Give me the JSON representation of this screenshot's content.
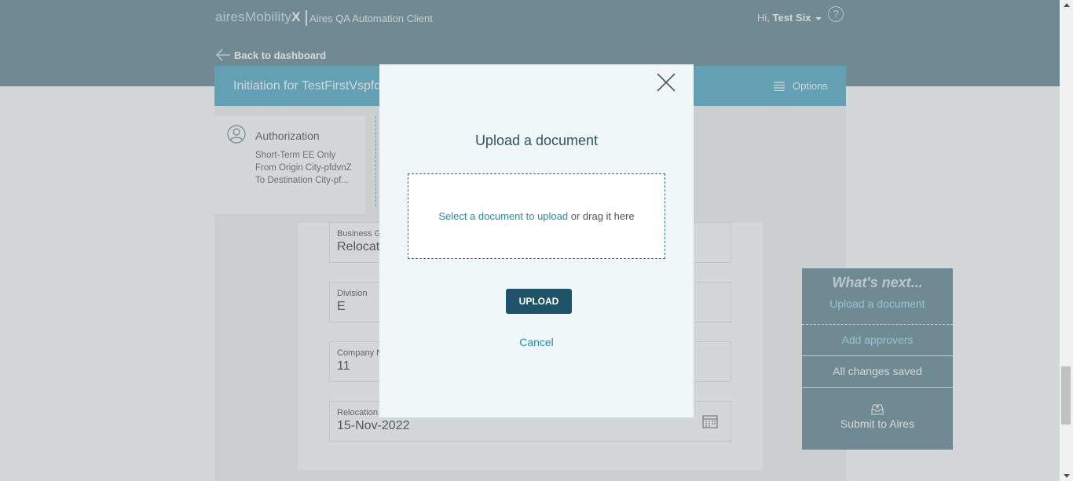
{
  "header": {
    "brand_main": "airesMobility",
    "brand_x": "X",
    "client_name": "Aires QA Automation Client",
    "greeting": "Hi,",
    "user_name": "Test Six",
    "help_symbol": "?",
    "back_label": "Back to dashboard"
  },
  "titlebar": {
    "title": "Initiation for TestFirstVspfdvnZ",
    "options_label": "Options"
  },
  "sidebar": {
    "section_title": "Authorization",
    "lines": [
      "Short-Term EE Only",
      "From Origin City-pfdvnZ",
      "To Destination City-pf..."
    ]
  },
  "form": {
    "fields": [
      {
        "label": "Business Group",
        "value": "Relocation"
      },
      {
        "label": "Division",
        "value": "E"
      },
      {
        "label": "Company Number",
        "value": "11"
      },
      {
        "label": "Relocation Date",
        "value": "15-Nov-2022"
      }
    ]
  },
  "whats_next": {
    "heading": "What's next...",
    "upload_link": "Upload a document",
    "approvers_link": "Add approvers",
    "saved_status": "All changes saved",
    "submit_label": "Submit to Aires"
  },
  "modal": {
    "title": "Upload a document",
    "select_link": "Select a document to upload",
    "drag_text": "or drag it here",
    "upload_button": "UPLOAD",
    "cancel_label": "Cancel"
  },
  "colors": {
    "header": "#6b8e99",
    "titlebar": "#5aaecb",
    "primary_button": "#1f5368",
    "link": "#1f8fae"
  }
}
